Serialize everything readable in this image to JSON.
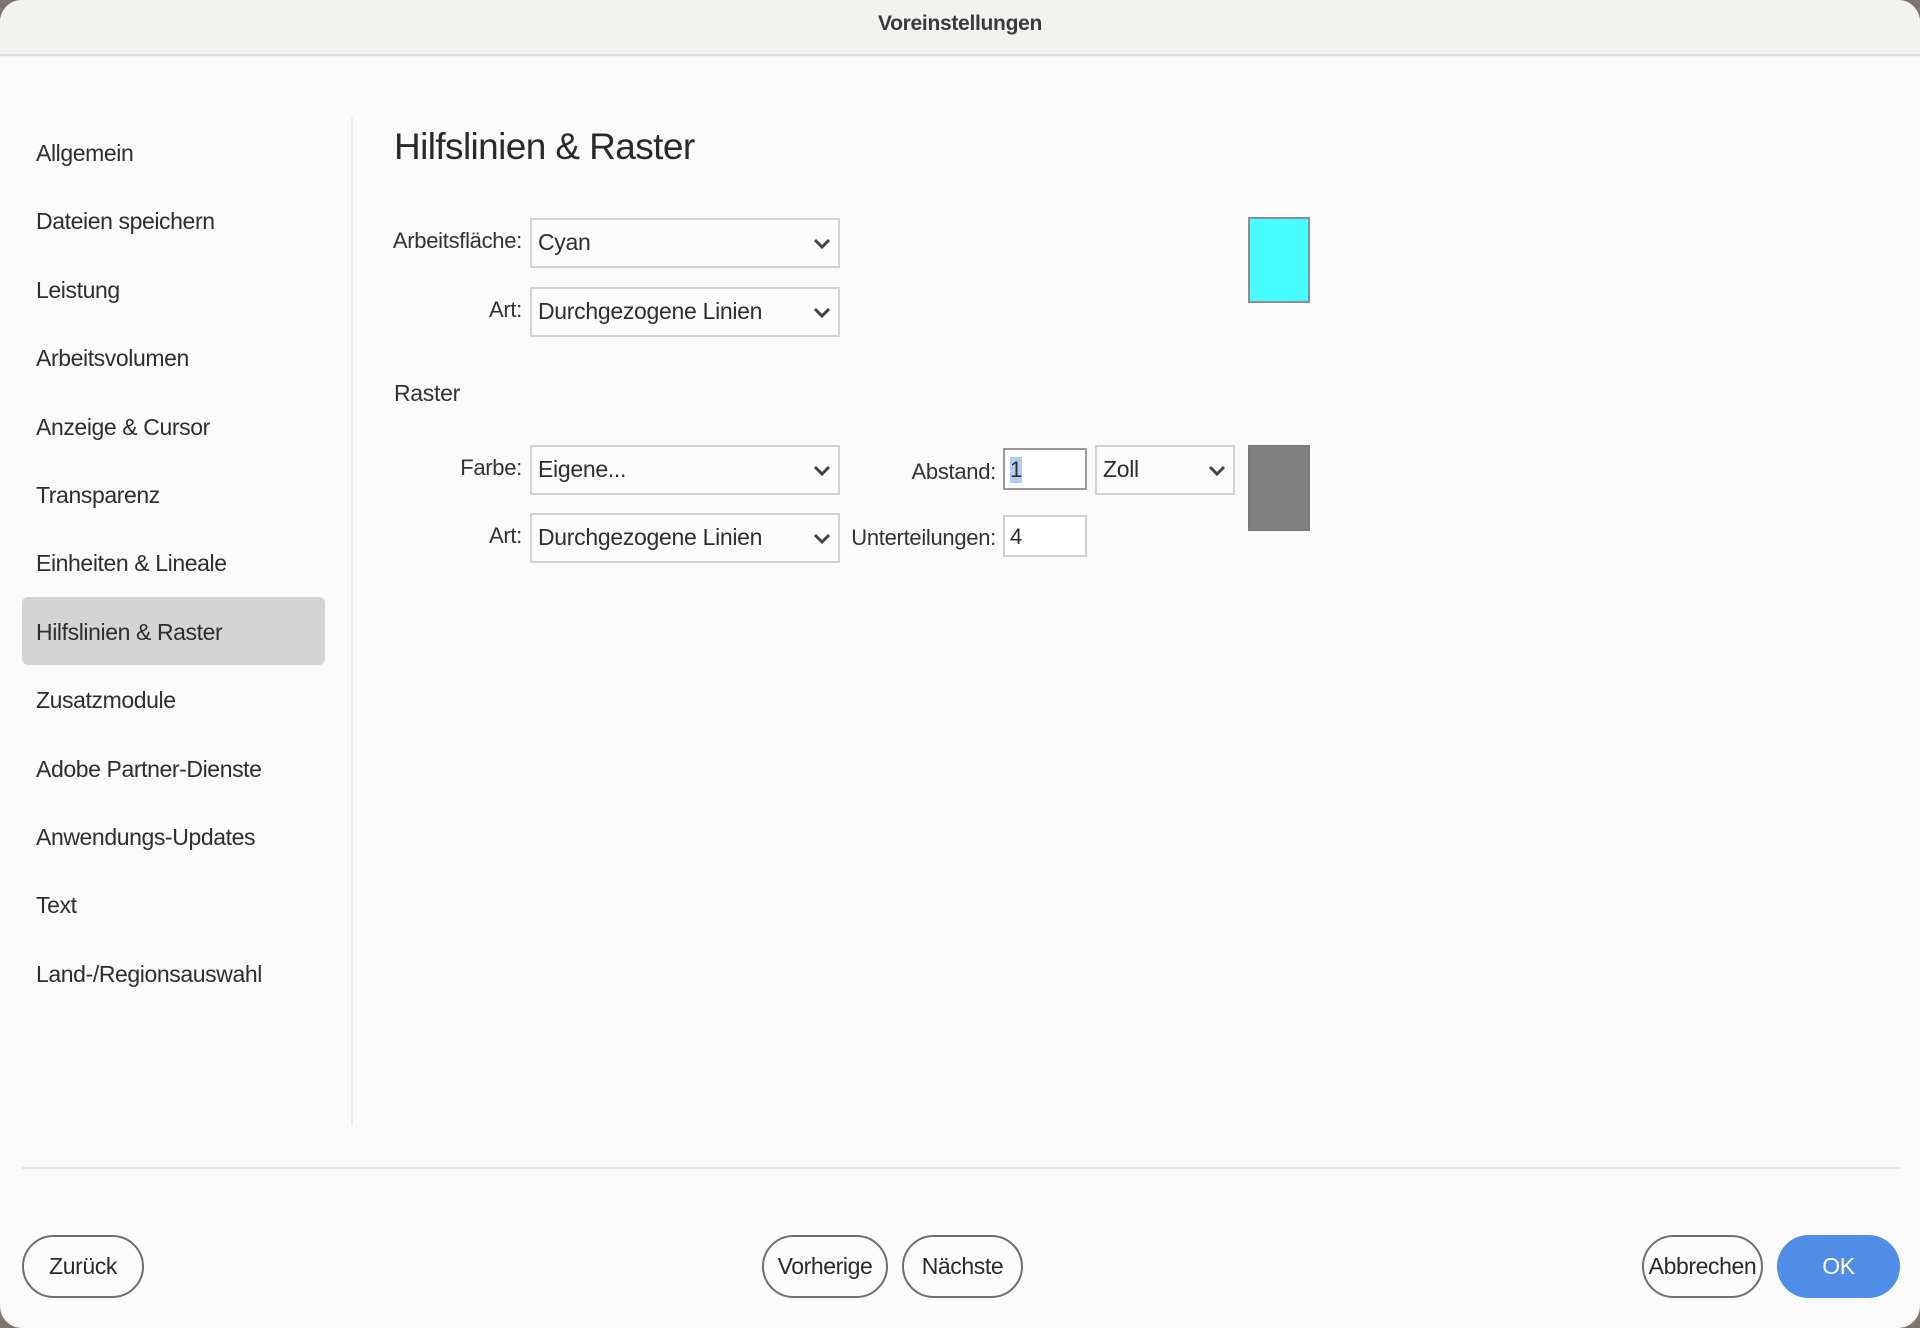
{
  "window": {
    "title": "Voreinstellungen"
  },
  "sidebar": {
    "items": [
      {
        "label": "Allgemein",
        "selected": false
      },
      {
        "label": "Dateien speichern",
        "selected": false
      },
      {
        "label": "Leistung",
        "selected": false
      },
      {
        "label": "Arbeitsvolumen",
        "selected": false
      },
      {
        "label": "Anzeige & Cursor",
        "selected": false
      },
      {
        "label": "Transparenz",
        "selected": false
      },
      {
        "label": "Einheiten & Lineale",
        "selected": false
      },
      {
        "label": "Hilfslinien & Raster",
        "selected": true
      },
      {
        "label": "Zusatzmodule",
        "selected": false
      },
      {
        "label": "Adobe Partner-Dienste",
        "selected": false
      },
      {
        "label": "Anwendungs-Updates",
        "selected": false
      },
      {
        "label": "Text",
        "selected": false
      },
      {
        "label": "Land-/Regionsauswahl",
        "selected": false
      }
    ]
  },
  "main": {
    "title": "Hilfslinien & Raster",
    "guides": {
      "canvas_label": "Arbeitsfläche:",
      "canvas_value": "Cyan",
      "style_label": "Art:",
      "style_value": "Durchgezogene Linien",
      "swatch_color": "#47fcff"
    },
    "grid": {
      "section_label": "Raster",
      "color_label": "Farbe:",
      "color_value": "Eigene...",
      "style_label": "Art:",
      "style_value": "Durchgezogene Linien",
      "spacing_label": "Abstand:",
      "spacing_value": "1",
      "unit_value": "Zoll",
      "subdivisions_label": "Unterteilungen:",
      "subdivisions_value": "4",
      "swatch_color": "#808080"
    }
  },
  "footer": {
    "back_label": "Zurück",
    "prev_label": "Vorherige",
    "next_label": "Nächste",
    "cancel_label": "Abbrechen",
    "ok_label": "OK"
  },
  "colors": {
    "accent": "#4f8de6",
    "selected_item_bg": "#d4d4d4"
  }
}
